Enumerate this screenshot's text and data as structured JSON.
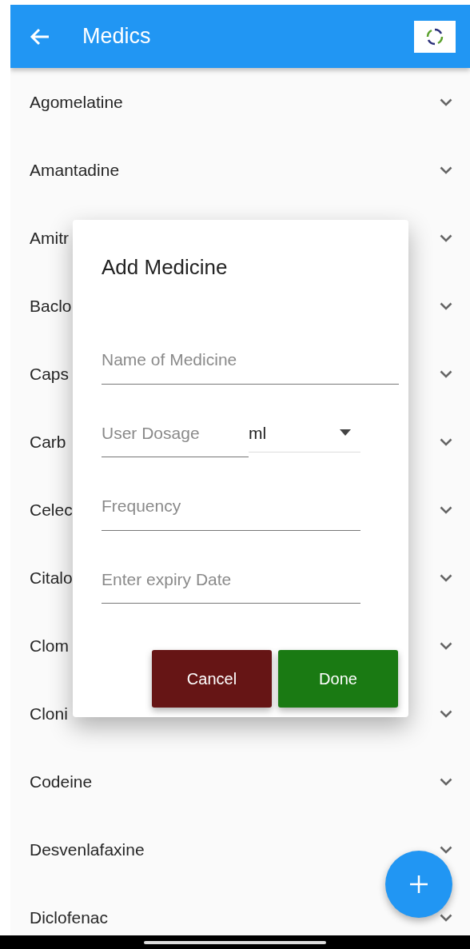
{
  "app_bar": {
    "title": "Medics"
  },
  "medicines": [
    {
      "name": "Agomelatine"
    },
    {
      "name": "Amantadine"
    },
    {
      "name": "Amitr"
    },
    {
      "name": "Baclo"
    },
    {
      "name": "Caps"
    },
    {
      "name": "Carb"
    },
    {
      "name": "Celec"
    },
    {
      "name": "Citalo"
    },
    {
      "name": "Clom"
    },
    {
      "name": "Cloni"
    },
    {
      "name": "Codeine"
    },
    {
      "name": "Desvenlafaxine"
    },
    {
      "name": "Diclofenac"
    }
  ],
  "dialog": {
    "title": "Add Medicine",
    "name_field": {
      "placeholder": "Name of Medicine"
    },
    "dosage_field": {
      "placeholder": "User Dosage"
    },
    "unit_select": {
      "value": "ml"
    },
    "frequency_field": {
      "placeholder": "Frequency"
    },
    "expiry_field": {
      "placeholder": "Enter expiry Date"
    },
    "buttons": [
      {
        "label": "Cancel",
        "kind": "cancel"
      },
      {
        "label": "Done",
        "kind": "confirm"
      }
    ]
  }
}
